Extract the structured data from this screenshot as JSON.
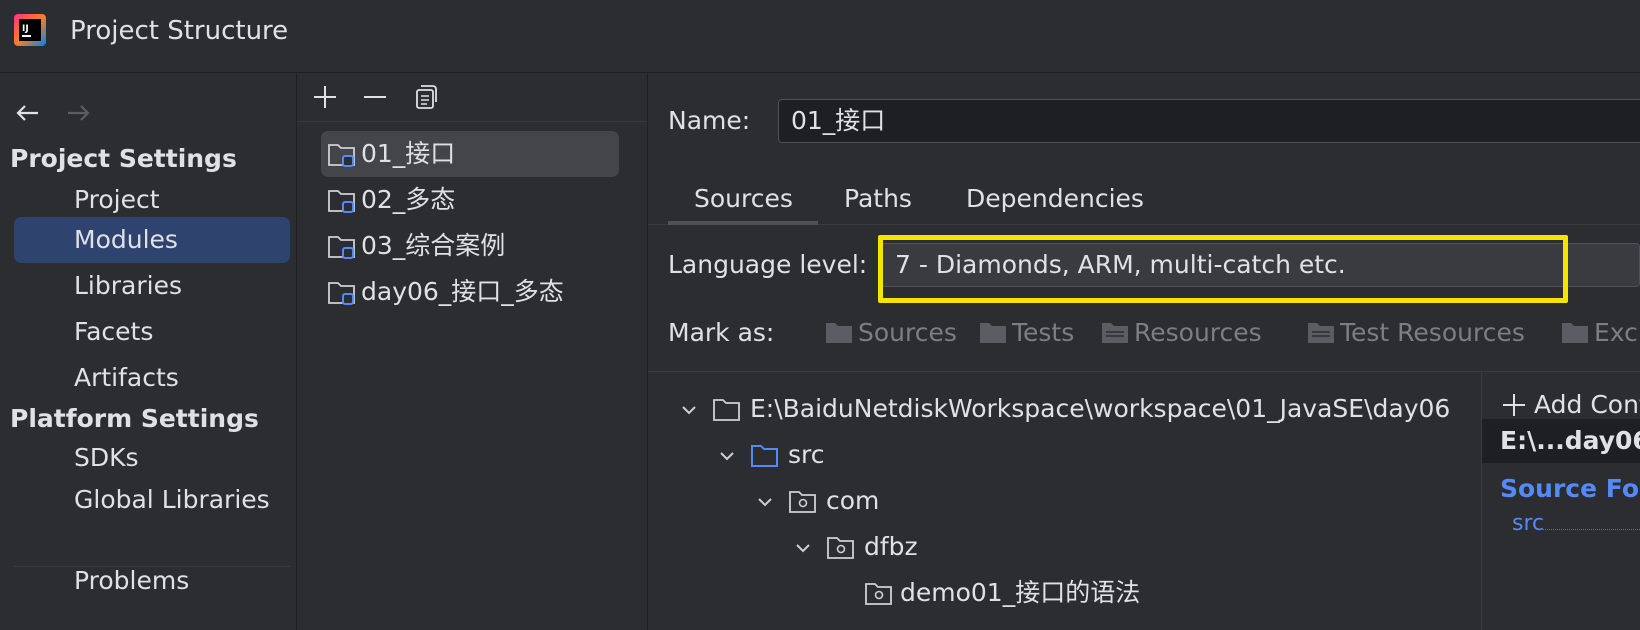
{
  "window": {
    "title": "Project Structure",
    "logo_text": "IJ"
  },
  "nav": {
    "back_icon": "arrow-left-icon",
    "forward_icon": "arrow-right-icon",
    "sections": [
      {
        "title": "Project Settings",
        "items": [
          "Project",
          "Modules",
          "Libraries",
          "Facets",
          "Artifacts"
        ]
      },
      {
        "title": "Platform Settings",
        "items": [
          "SDKs",
          "Global Libraries"
        ]
      }
    ],
    "selected_item": "Modules",
    "bottom_items": [
      "Problems"
    ]
  },
  "module_list": {
    "toolbar_icons": [
      "plus-icon",
      "minus-icon",
      "copy-icon"
    ],
    "items": [
      "01_接口",
      "02_多态",
      "03_综合案例",
      "day06_接口_多态"
    ],
    "selected_index": 0
  },
  "module_settings": {
    "name_label": "Name:",
    "name_value": "01_接口",
    "tabs": [
      "Sources",
      "Paths",
      "Dependencies"
    ],
    "active_tab": "Sources",
    "language_level_label": "Language level:",
    "language_level_value": "7 - Diamonds, ARM, multi-catch etc.",
    "highlight_color": "#f5e400",
    "mark_as_label": "Mark as:",
    "mark_as_buttons": [
      "Sources",
      "Tests",
      "Resources",
      "Test Resources",
      "Excluded"
    ],
    "tree": [
      {
        "label": "E:\\BaiduNetdiskWorkspace\\workspace\\01_JavaSE\\day06",
        "level": 0,
        "icon": "folder-icon",
        "expanded": true
      },
      {
        "label": "src",
        "level": 1,
        "icon": "source-folder-icon",
        "expanded": true
      },
      {
        "label": "com",
        "level": 2,
        "icon": "package-icon",
        "expanded": true
      },
      {
        "label": "dfbz",
        "level": 3,
        "icon": "package-icon",
        "expanded": true
      },
      {
        "label": "demo01_接口的语法",
        "level": 4,
        "icon": "package-icon",
        "expanded": false
      }
    ],
    "content_root": {
      "add_label": "Add Content Root",
      "root_path": "E:\\...day06",
      "source_folders_title": "Source Folders",
      "source_folder": "src"
    }
  },
  "colors": {
    "background": "#2b2d30",
    "selection_nav": "#2e436e",
    "selection_list": "#43454a",
    "source_blue": "#548af7"
  }
}
